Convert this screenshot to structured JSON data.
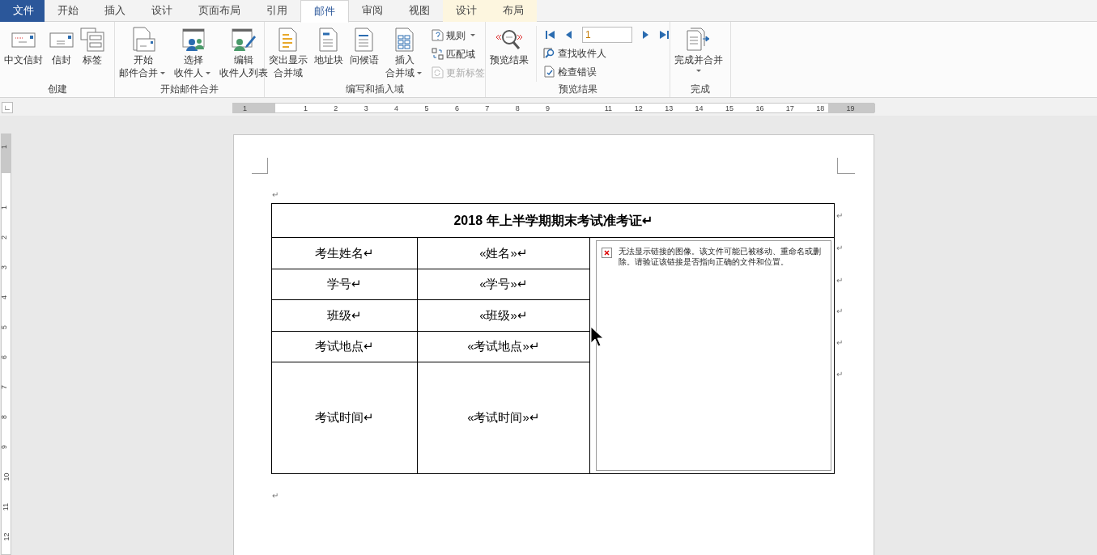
{
  "tabs": [
    {
      "label": "文件",
      "kind": "file",
      "selected": false
    },
    {
      "label": "开始",
      "kind": "normal",
      "selected": false
    },
    {
      "label": "插入",
      "kind": "normal",
      "selected": false
    },
    {
      "label": "设计",
      "kind": "normal",
      "selected": false
    },
    {
      "label": "页面布局",
      "kind": "normal",
      "selected": false
    },
    {
      "label": "引用",
      "kind": "normal",
      "selected": false
    },
    {
      "label": "邮件",
      "kind": "normal",
      "selected": true
    },
    {
      "label": "审阅",
      "kind": "normal",
      "selected": false
    },
    {
      "label": "视图",
      "kind": "normal",
      "selected": false
    },
    {
      "label": "设计",
      "kind": "context",
      "selected": false
    },
    {
      "label": "布局",
      "kind": "context",
      "selected": false
    }
  ],
  "groups": [
    {
      "label": "创建",
      "columns": [
        {
          "kind": "large",
          "lines": [
            "中文信封"
          ],
          "dropdown": false
        },
        {
          "kind": "large",
          "lines": [
            "信封"
          ],
          "dropdown": false
        },
        {
          "kind": "large",
          "lines": [
            "标签"
          ],
          "dropdown": false
        }
      ]
    },
    {
      "label": "开始邮件合并",
      "columns": [
        {
          "kind": "large",
          "lines": [
            "开始",
            "邮件合并"
          ],
          "dropdown": true
        },
        {
          "kind": "large",
          "lines": [
            "选择",
            "收件人"
          ],
          "dropdown": true
        },
        {
          "kind": "large",
          "lines": [
            "编辑",
            "收件人列表"
          ],
          "dropdown": false
        }
      ]
    },
    {
      "label": "编写和插入域",
      "columns": [
        {
          "kind": "large",
          "lines": [
            "突出显示",
            "合并域"
          ],
          "dropdown": false
        },
        {
          "kind": "large",
          "lines": [
            "地址块"
          ],
          "dropdown": false
        },
        {
          "kind": "large",
          "lines": [
            "问候语"
          ],
          "dropdown": false
        },
        {
          "kind": "large",
          "lines": [
            "插入",
            "合并域"
          ],
          "dropdown": true
        },
        {
          "kind": "stack",
          "items": [
            {
              "label": "规则",
              "dropdown": true,
              "disabled": false
            },
            {
              "label": "匹配域",
              "dropdown": false,
              "disabled": false
            },
            {
              "label": "更新标签",
              "dropdown": false,
              "disabled": true
            }
          ]
        }
      ]
    },
    {
      "label": "预览结果",
      "columns": [
        {
          "kind": "large",
          "lines": [
            "预览结果"
          ],
          "dropdown": false
        },
        {
          "kind": "nav",
          "value": "1",
          "items": [
            {
              "label": "查找收件人",
              "dropdown": false,
              "disabled": false
            },
            {
              "label": "检查错误",
              "dropdown": false,
              "disabled": false
            }
          ]
        }
      ]
    },
    {
      "label": "完成",
      "columns": [
        {
          "kind": "large",
          "lines": [
            "完成并合并"
          ],
          "dropdown": true,
          "dropdown_below": true
        }
      ]
    }
  ],
  "ruler": {
    "corner": "∟",
    "labels": [
      "1",
      "1",
      "2",
      "3",
      "4",
      "5",
      "6",
      "7",
      "8",
      "9",
      "11",
      "12",
      "13",
      "14",
      "15",
      "16",
      "17",
      "18",
      "19"
    ],
    "vertical_labels": [
      "1",
      "1",
      "2",
      "3",
      "4",
      "5",
      "6",
      "7",
      "8",
      "9",
      "10",
      "11",
      "12"
    ]
  },
  "document": {
    "before_mark": "↵",
    "after_mark": "↵",
    "table": {
      "title": "2018 年上半学期期末考试准考证↵",
      "rows": [
        [
          "考生姓名↵",
          "«姓名»↵"
        ],
        [
          "学号↵",
          "«学号»↵"
        ],
        [
          "班级↵",
          "«班级»↵"
        ],
        [
          "考试地点↵",
          "«考试地点»↵"
        ],
        [
          "考试时间↵",
          "«考试时间»↵"
        ]
      ],
      "row_end_marks": [
        "↵",
        "↵",
        "↵",
        "↵",
        "↵",
        "↵"
      ],
      "image_error": "无法显示链接的图像。该文件可能已被移动、重命名或删除。请验证该链接是否指向正确的文件和位置。"
    }
  }
}
